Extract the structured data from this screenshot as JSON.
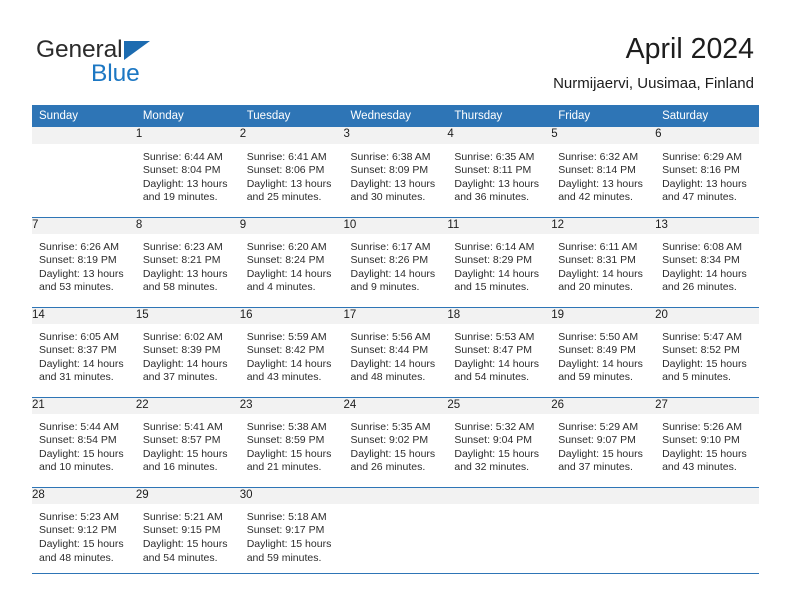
{
  "brand": {
    "name_part1": "General",
    "name_part2": "Blue",
    "logo_icon": "triangle-flag-icon",
    "accent_color": "#1c77c3",
    "header_color": "#2e75b6"
  },
  "header": {
    "title": "April 2024",
    "subtitle": "Nurmijaervi, Uusimaa, Finland"
  },
  "calendar": {
    "weekday_headers": [
      "Sunday",
      "Monday",
      "Tuesday",
      "Wednesday",
      "Thursday",
      "Friday",
      "Saturday"
    ],
    "weeks": [
      [
        {
          "day": "",
          "lines": []
        },
        {
          "day": "1",
          "lines": [
            "Sunrise: 6:44 AM",
            "Sunset: 8:04 PM",
            "Daylight: 13 hours",
            "and 19 minutes."
          ]
        },
        {
          "day": "2",
          "lines": [
            "Sunrise: 6:41 AM",
            "Sunset: 8:06 PM",
            "Daylight: 13 hours",
            "and 25 minutes."
          ]
        },
        {
          "day": "3",
          "lines": [
            "Sunrise: 6:38 AM",
            "Sunset: 8:09 PM",
            "Daylight: 13 hours",
            "and 30 minutes."
          ]
        },
        {
          "day": "4",
          "lines": [
            "Sunrise: 6:35 AM",
            "Sunset: 8:11 PM",
            "Daylight: 13 hours",
            "and 36 minutes."
          ]
        },
        {
          "day": "5",
          "lines": [
            "Sunrise: 6:32 AM",
            "Sunset: 8:14 PM",
            "Daylight: 13 hours",
            "and 42 minutes."
          ]
        },
        {
          "day": "6",
          "lines": [
            "Sunrise: 6:29 AM",
            "Sunset: 8:16 PM",
            "Daylight: 13 hours",
            "and 47 minutes."
          ]
        }
      ],
      [
        {
          "day": "7",
          "lines": [
            "Sunrise: 6:26 AM",
            "Sunset: 8:19 PM",
            "Daylight: 13 hours",
            "and 53 minutes."
          ]
        },
        {
          "day": "8",
          "lines": [
            "Sunrise: 6:23 AM",
            "Sunset: 8:21 PM",
            "Daylight: 13 hours",
            "and 58 minutes."
          ]
        },
        {
          "day": "9",
          "lines": [
            "Sunrise: 6:20 AM",
            "Sunset: 8:24 PM",
            "Daylight: 14 hours",
            "and 4 minutes."
          ]
        },
        {
          "day": "10",
          "lines": [
            "Sunrise: 6:17 AM",
            "Sunset: 8:26 PM",
            "Daylight: 14 hours",
            "and 9 minutes."
          ]
        },
        {
          "day": "11",
          "lines": [
            "Sunrise: 6:14 AM",
            "Sunset: 8:29 PM",
            "Daylight: 14 hours",
            "and 15 minutes."
          ]
        },
        {
          "day": "12",
          "lines": [
            "Sunrise: 6:11 AM",
            "Sunset: 8:31 PM",
            "Daylight: 14 hours",
            "and 20 minutes."
          ]
        },
        {
          "day": "13",
          "lines": [
            "Sunrise: 6:08 AM",
            "Sunset: 8:34 PM",
            "Daylight: 14 hours",
            "and 26 minutes."
          ]
        }
      ],
      [
        {
          "day": "14",
          "lines": [
            "Sunrise: 6:05 AM",
            "Sunset: 8:37 PM",
            "Daylight: 14 hours",
            "and 31 minutes."
          ]
        },
        {
          "day": "15",
          "lines": [
            "Sunrise: 6:02 AM",
            "Sunset: 8:39 PM",
            "Daylight: 14 hours",
            "and 37 minutes."
          ]
        },
        {
          "day": "16",
          "lines": [
            "Sunrise: 5:59 AM",
            "Sunset: 8:42 PM",
            "Daylight: 14 hours",
            "and 43 minutes."
          ]
        },
        {
          "day": "17",
          "lines": [
            "Sunrise: 5:56 AM",
            "Sunset: 8:44 PM",
            "Daylight: 14 hours",
            "and 48 minutes."
          ]
        },
        {
          "day": "18",
          "lines": [
            "Sunrise: 5:53 AM",
            "Sunset: 8:47 PM",
            "Daylight: 14 hours",
            "and 54 minutes."
          ]
        },
        {
          "day": "19",
          "lines": [
            "Sunrise: 5:50 AM",
            "Sunset: 8:49 PM",
            "Daylight: 14 hours",
            "and 59 minutes."
          ]
        },
        {
          "day": "20",
          "lines": [
            "Sunrise: 5:47 AM",
            "Sunset: 8:52 PM",
            "Daylight: 15 hours",
            "and 5 minutes."
          ]
        }
      ],
      [
        {
          "day": "21",
          "lines": [
            "Sunrise: 5:44 AM",
            "Sunset: 8:54 PM",
            "Daylight: 15 hours",
            "and 10 minutes."
          ]
        },
        {
          "day": "22",
          "lines": [
            "Sunrise: 5:41 AM",
            "Sunset: 8:57 PM",
            "Daylight: 15 hours",
            "and 16 minutes."
          ]
        },
        {
          "day": "23",
          "lines": [
            "Sunrise: 5:38 AM",
            "Sunset: 8:59 PM",
            "Daylight: 15 hours",
            "and 21 minutes."
          ]
        },
        {
          "day": "24",
          "lines": [
            "Sunrise: 5:35 AM",
            "Sunset: 9:02 PM",
            "Daylight: 15 hours",
            "and 26 minutes."
          ]
        },
        {
          "day": "25",
          "lines": [
            "Sunrise: 5:32 AM",
            "Sunset: 9:04 PM",
            "Daylight: 15 hours",
            "and 32 minutes."
          ]
        },
        {
          "day": "26",
          "lines": [
            "Sunrise: 5:29 AM",
            "Sunset: 9:07 PM",
            "Daylight: 15 hours",
            "and 37 minutes."
          ]
        },
        {
          "day": "27",
          "lines": [
            "Sunrise: 5:26 AM",
            "Sunset: 9:10 PM",
            "Daylight: 15 hours",
            "and 43 minutes."
          ]
        }
      ],
      [
        {
          "day": "28",
          "lines": [
            "Sunrise: 5:23 AM",
            "Sunset: 9:12 PM",
            "Daylight: 15 hours",
            "and 48 minutes."
          ]
        },
        {
          "day": "29",
          "lines": [
            "Sunrise: 5:21 AM",
            "Sunset: 9:15 PM",
            "Daylight: 15 hours",
            "and 54 minutes."
          ]
        },
        {
          "day": "30",
          "lines": [
            "Sunrise: 5:18 AM",
            "Sunset: 9:17 PM",
            "Daylight: 15 hours",
            "and 59 minutes."
          ]
        },
        {
          "day": "",
          "lines": []
        },
        {
          "day": "",
          "lines": []
        },
        {
          "day": "",
          "lines": []
        },
        {
          "day": "",
          "lines": []
        }
      ]
    ]
  }
}
